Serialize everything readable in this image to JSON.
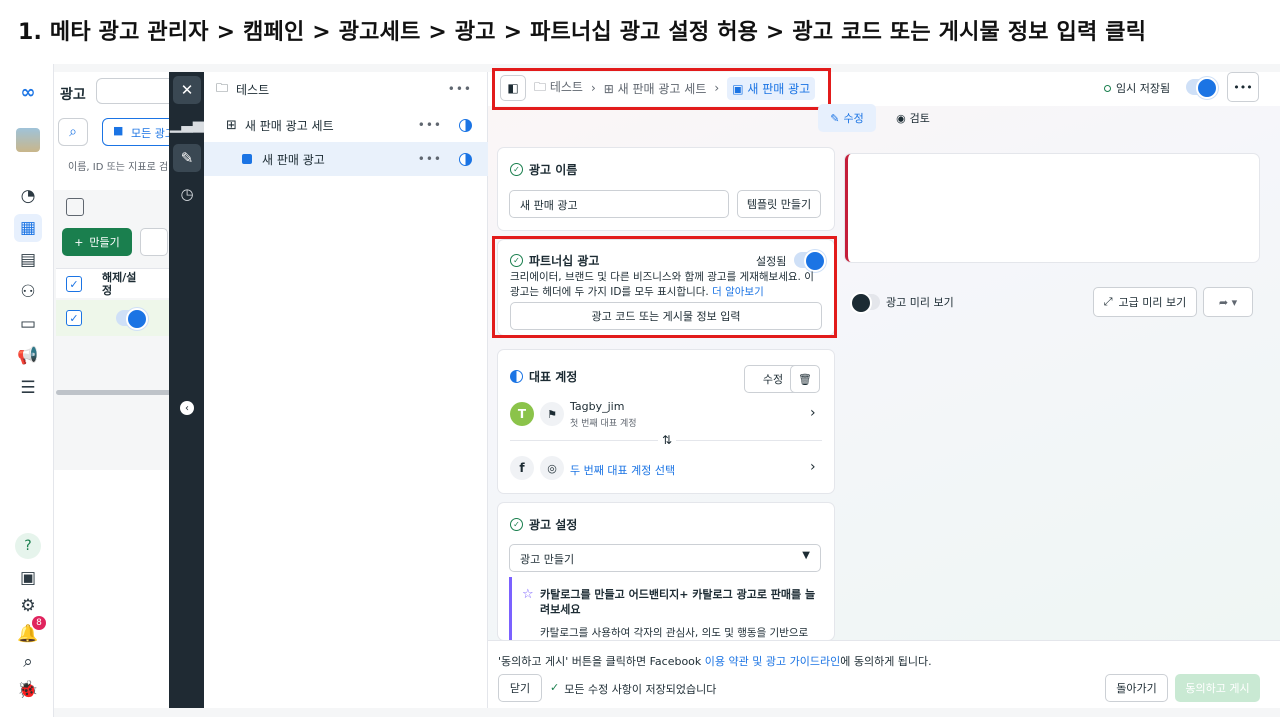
{
  "instruction": "1. 메타 광고 관리자 > 캠페인 > 광고세트 > 광고 > 파트너십 광고 설정 허용 > 광고 코드 또는 게시물 정보 입력 클릭",
  "rail": {
    "notification_count": "8"
  },
  "ads_manager": {
    "title": "광고",
    "all_ads_label": "모든 광고",
    "search_hint": "이름, ID 또는 지표로 검",
    "create_label": "만들기",
    "col_onoff": "해제/설정"
  },
  "tree": {
    "campaign": "테스트",
    "adset": "새 판매 광고 세트",
    "ad": "새 판매 광고",
    "more": "•••"
  },
  "breadcrumb": {
    "campaign": "테스트",
    "adset": "새 판매 광고 세트",
    "ad": "새 판매 광고"
  },
  "topbar": {
    "draft_status": "임시 저장됨",
    "more": "•••",
    "edit_tab": "수정",
    "review_tab": "검토"
  },
  "ad_name": {
    "title": "광고 이름",
    "value": "새 판매 광고",
    "template_button": "템플릿 만들기"
  },
  "partnership": {
    "title": "파트너십 광고",
    "status": "설정됨",
    "description": "크리에이터, 브랜드 및 다른 비즈니스와 함께 광고를 게재해보세요. 이 광고는 헤더에 두 가지 ID를 모두 표시합니다.",
    "learn_more": "더 알아보기",
    "enter_code_button": "광고 코드 또는 게시물 정보 입력"
  },
  "identity": {
    "title": "대표 계정",
    "edit_button": "수정",
    "first_account": "Tagby_jim",
    "first_account_sub": "첫 번째 대표 계정",
    "avatar_letter": "T",
    "second_account_select": "두 번째 대표 계정 선택"
  },
  "ad_setup": {
    "title": "광고 설정",
    "dropdown_value": "광고 만들기",
    "promo_title": "카탈로그를 만들고 어드밴티지+ 카탈로그 광고로 판매를 늘려보세요",
    "promo_body": "카탈로그를 사용하여 각자의 관심사, 의도 및 행동을 기반으로"
  },
  "preview": {
    "toggle_label": "광고 미리 보기",
    "advanced_button": "고급 미리 보기"
  },
  "footer": {
    "terms_prefix": "'동의하고 게시' 버튼을 클릭하면 Facebook ",
    "terms_link": "이용 약관 및 광고 가이드라인",
    "terms_suffix": "에 동의하게 됩니다.",
    "close_button": "닫기",
    "saved_status": "모든 수정 사항이 저장되었습니다",
    "back_button": "돌아가기",
    "publish_button": "동의하고 게시"
  },
  "colors": {
    "highlight": "#e21b1b",
    "accent": "#1b74e4",
    "green": "#1a7f4e"
  }
}
